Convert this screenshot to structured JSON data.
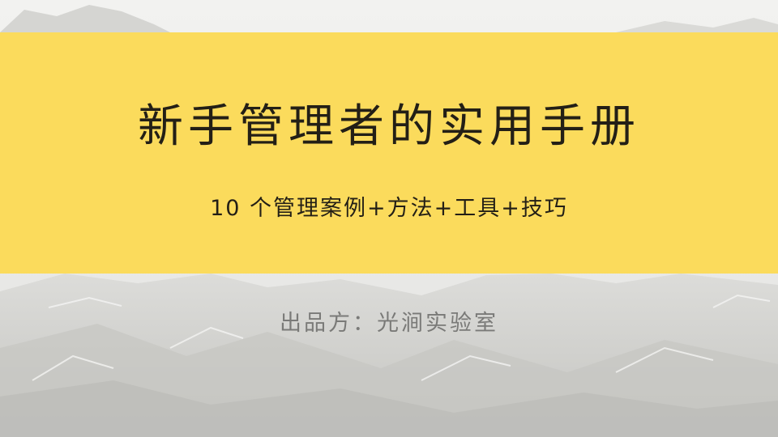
{
  "banner": {
    "title": "新手管理者的实用手册",
    "subtitle": "10 个管理案例+方法+工具+技巧"
  },
  "footer": {
    "publisher": "出品方：光涧实验室"
  },
  "colors": {
    "banner": "#fbdb5c",
    "title_text": "#231f16",
    "publisher_text": "#7a7a78"
  }
}
